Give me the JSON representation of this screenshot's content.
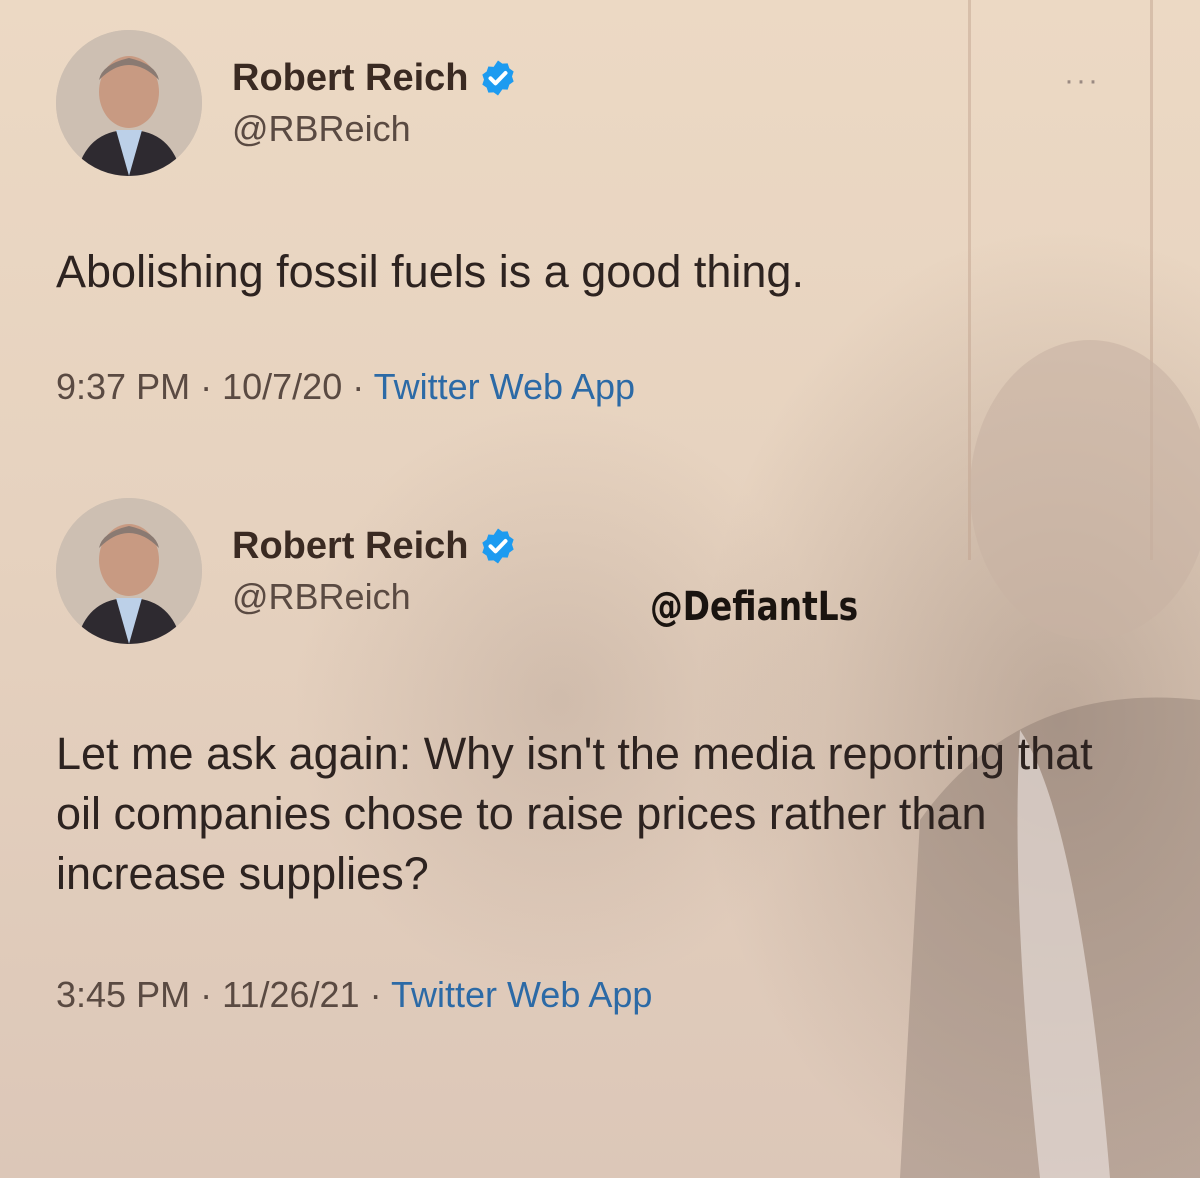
{
  "tweets": [
    {
      "author_name": "Robert Reich",
      "author_handle": "@RBReich",
      "text": "Abolishing fossil fuels is a good thing.",
      "time": "9:37 PM",
      "date": "10/7/20",
      "source": "Twitter Web App",
      "separator": "·",
      "more_glyph": "···"
    },
    {
      "author_name": "Robert Reich",
      "author_handle": "@RBReich",
      "text": "Let me ask again: Why isn't the media reporting that oil companies chose to raise prices rather than increase supplies?",
      "time": "3:45 PM",
      "date": "11/26/21",
      "source": "Twitter Web App",
      "separator": "·"
    }
  ],
  "watermark": "@DefiantLs",
  "colors": {
    "verified": "#1d9bf0",
    "source_link": "#2c6aa6",
    "background": "#e8d4c0"
  },
  "icons": {
    "verified": "verified-badge-icon",
    "more": "more-options-icon"
  }
}
